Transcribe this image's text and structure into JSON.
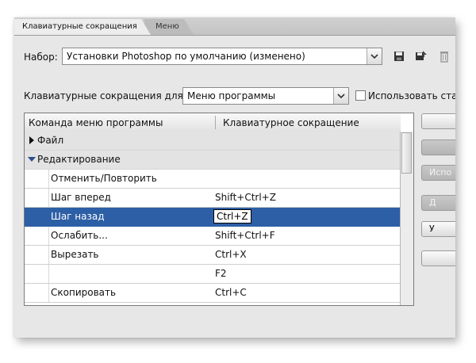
{
  "tabs": [
    {
      "label": "Клавиатурные сокращения",
      "active": true
    },
    {
      "label": "Меню",
      "active": false
    }
  ],
  "preset": {
    "label": "Набор:",
    "value": "Установки Photoshop по умолчанию (изменено)",
    "icons": [
      "save-icon",
      "save-as-icon",
      "delete-icon"
    ]
  },
  "shortcuts_for": {
    "label": "Клавиатурные сокращения для:",
    "value": "Меню программы",
    "checkbox_label": "Использовать ста"
  },
  "table": {
    "headers": [
      "Команда меню программы",
      "Клавиатурное сокращение"
    ],
    "rows": [
      {
        "type": "section",
        "expanded": false,
        "command": "Файл",
        "shortcut": ""
      },
      {
        "type": "section",
        "expanded": true,
        "command": "Редактирование",
        "shortcut": ""
      },
      {
        "type": "item",
        "command": "Отменить/Повторить",
        "shortcut": ""
      },
      {
        "type": "item",
        "command": "Шаг вперед",
        "shortcut": "Shift+Ctrl+Z"
      },
      {
        "type": "item",
        "command": "Шаг назад",
        "shortcut": "Ctrl+Z",
        "selected": true
      },
      {
        "type": "item",
        "command": "Ослабить...",
        "shortcut": "Shift+Ctrl+F"
      },
      {
        "type": "item",
        "command": "Вырезать",
        "shortcut": "Ctrl+X"
      },
      {
        "type": "item",
        "command": "",
        "shortcut": "F2"
      },
      {
        "type": "item",
        "command": "Скопировать",
        "shortcut": "Ctrl+C"
      }
    ]
  },
  "side_buttons": [
    {
      "label": "",
      "enabled": true
    },
    {
      "label": "",
      "enabled": false
    },
    {
      "label": "Испо",
      "enabled": false
    },
    {
      "label": "Д",
      "enabled": false
    },
    {
      "label": "У",
      "enabled": true
    },
    {
      "label": "",
      "enabled": true
    }
  ],
  "colors": {
    "selection": "#2d5fa6",
    "panel": "#e7e7e7"
  }
}
